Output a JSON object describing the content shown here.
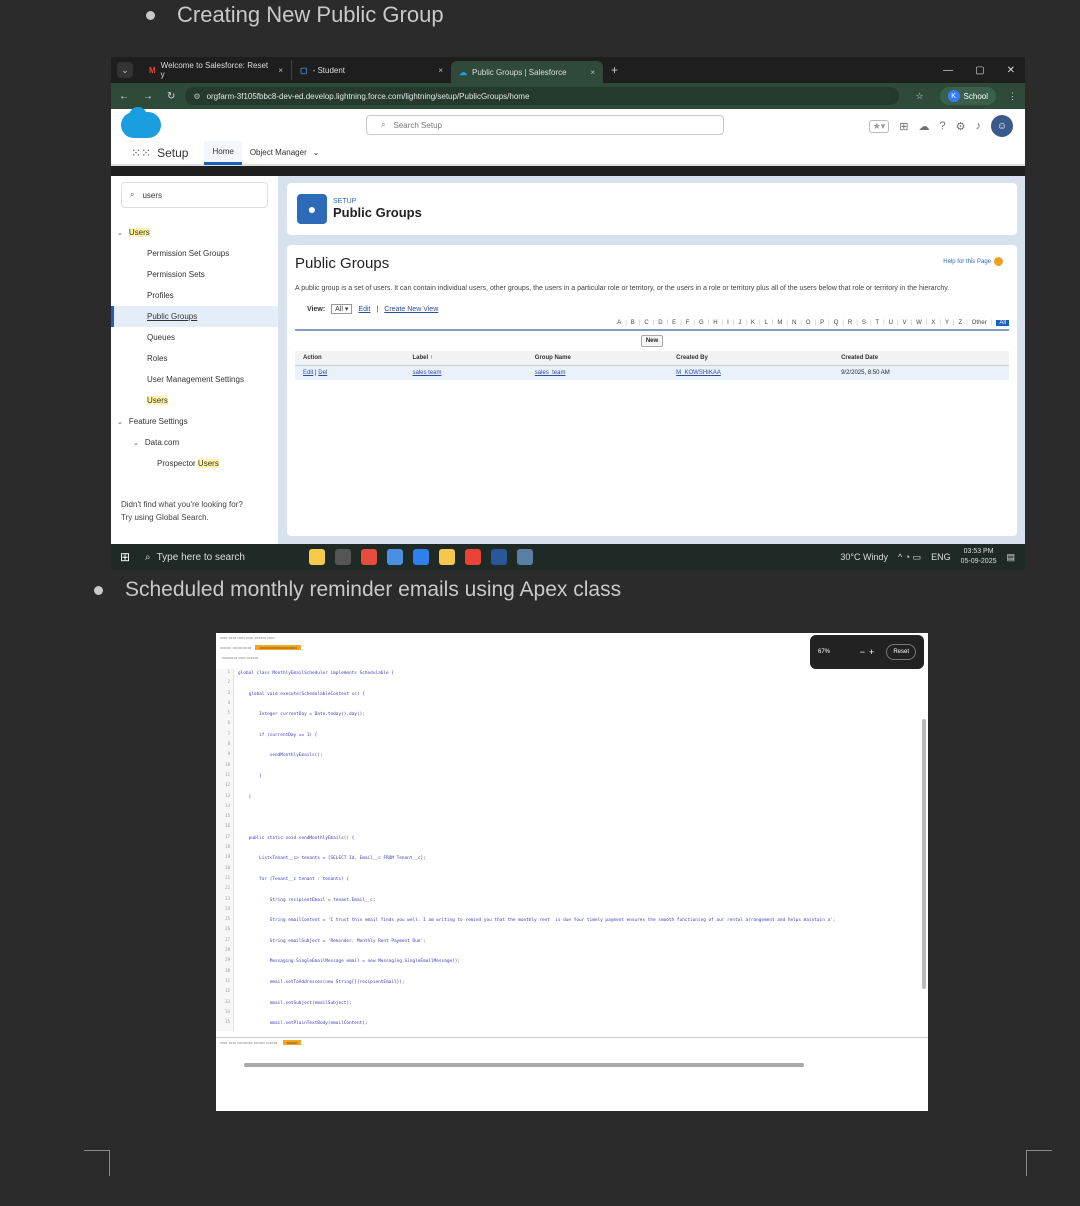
{
  "doc": {
    "bullet1": "Creating New Public Group",
    "bullet2": "Scheduled monthly reminder emails using Apex class"
  },
  "browser": {
    "tabs": [
      {
        "icon": "M",
        "label": "Welcome to Salesforce: Reset y",
        "close": "×"
      },
      {
        "icon": "▢",
        "label": "- Student",
        "close": "×"
      },
      {
        "icon": "☁",
        "label": "Public Groups | Salesforce",
        "close": "×"
      }
    ],
    "new_tab": "+",
    "url": "orgfarm-3f105fbbc8-dev-ed.develop.lightning.force.com/lightning/setup/PublicGroups/home",
    "profile": "School",
    "profile_initial": "K"
  },
  "sf": {
    "search_placeholder": "Search Setup",
    "app_title": "Setup",
    "nav_home": "Home",
    "nav_object_manager": "Object Manager",
    "quickfind_value": "users",
    "tree": {
      "users": "Users",
      "permission_set_groups": "Permission Set Groups",
      "permission_sets": "Permission Sets",
      "profiles": "Profiles",
      "public_groups": "Public Groups",
      "queues": "Queues",
      "roles": "Roles",
      "user_management_settings": "User Management Settings",
      "users_item": "Users",
      "feature_settings": "Feature Settings",
      "data_com": "Data.com",
      "prospector": "Prospector",
      "prospector_users": "Users"
    },
    "side_footer_1": "Didn't find what you're looking for?",
    "side_footer_2": "Try using Global Search.",
    "setup_label": "SETUP",
    "page_title": "Public Groups",
    "main_heading": "Public Groups",
    "help_link": "Help for this Page",
    "description": "A public group is a set of users. It can contain individual users, other groups, the users in a particular role or territory, or the users in a role or territory plus all of the users below that role or territory in the hierarchy.",
    "view_label": "View:",
    "view_value": "All",
    "edit_link": "Edit",
    "create_view_link": "Create New View",
    "alphabet": [
      "A",
      "B",
      "C",
      "D",
      "E",
      "F",
      "G",
      "H",
      "I",
      "J",
      "K",
      "L",
      "M",
      "N",
      "O",
      "P",
      "Q",
      "R",
      "S",
      "T",
      "U",
      "V",
      "W",
      "X",
      "Y",
      "Z",
      "Other"
    ],
    "all_label": "All",
    "new_button": "New",
    "table": {
      "headers": [
        "Action",
        "Label ↑",
        "Group Name",
        "Created By",
        "Created Date"
      ],
      "row": {
        "edit": "Edit",
        "del": "Del",
        "label": "sales team",
        "group_name": "sales_team",
        "created_by": "M_KOWSHIKAA",
        "created_date": "9/2/2025, 8:50 AM"
      }
    }
  },
  "taskbar": {
    "search_placeholder": "Type here to search",
    "weather": "30°C  Windy",
    "lang": "ENG",
    "time": "03:53 PM",
    "date": "05-09-2025"
  },
  "ide": {
    "zoom": "67%",
    "reset": "Reset",
    "code": [
      "global class MonthlyEmailScheduler implements Schedulable {",
      "    global void execute(SchedulableContext sc) {",
      "        Integer currentDay = Date.today().day();",
      "        if (currentDay == 1) {",
      "            sendMonthlyEmails();",
      "        }",
      "    }",
      "",
      "    public static void sendMonthlyEmails() {",
      "        List<Tenant__c> tenants = [SELECT Id, Email__c FROM Tenant__c];",
      "        for (Tenant__c tenant : tenants) {",
      "            String recipientEmail = tenant.Email__c;",
      "            String emailContent = 'I trust this email finds you well. I am writing to remind you that the monthly rent  is due Your timely payment ensures the smooth functioning of our rental arrangement and helps maintain a';",
      "            String emailSubject = 'Reminder: Monthly Rent Payment Due';",
      "            Messaging.SingleEmailMessage email = new Messaging.SingleEmailMessage();",
      "            email.setToAddresses(new String[]{recipientEmail});",
      "            email.setSubject(emailSubject);",
      "            email.setPlainTextBody(emailContent);"
    ]
  }
}
